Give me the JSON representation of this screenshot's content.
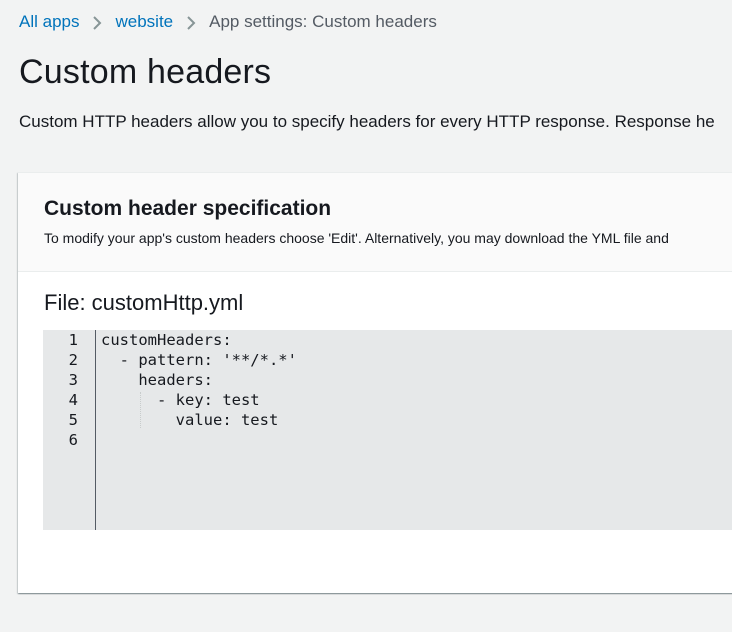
{
  "breadcrumb": {
    "items": [
      {
        "label": "All apps"
      },
      {
        "label": "website"
      },
      {
        "label": "App settings: Custom headers"
      }
    ]
  },
  "page": {
    "title": "Custom headers",
    "description": "Custom HTTP headers allow you to specify headers for every HTTP response. Response he"
  },
  "card": {
    "title": "Custom header specification",
    "subtitle": "To modify your app's custom headers choose 'Edit'. Alternatively, you may download the YML file and"
  },
  "file": {
    "label": "File: customHttp.yml"
  },
  "editor": {
    "line_numbers": [
      "1",
      "2",
      "3",
      "4",
      "5",
      "6"
    ],
    "lines": [
      "customHeaders:",
      "  - pattern: '**/*.*'",
      "    headers:",
      "      - key: test",
      "        value: test",
      ""
    ]
  },
  "icons": {
    "breadcrumb_separator": "chevron-right-icon"
  },
  "colors": {
    "link": "#0073bb",
    "background": "#f2f3f3",
    "editor_background": "#e6e8e9"
  }
}
